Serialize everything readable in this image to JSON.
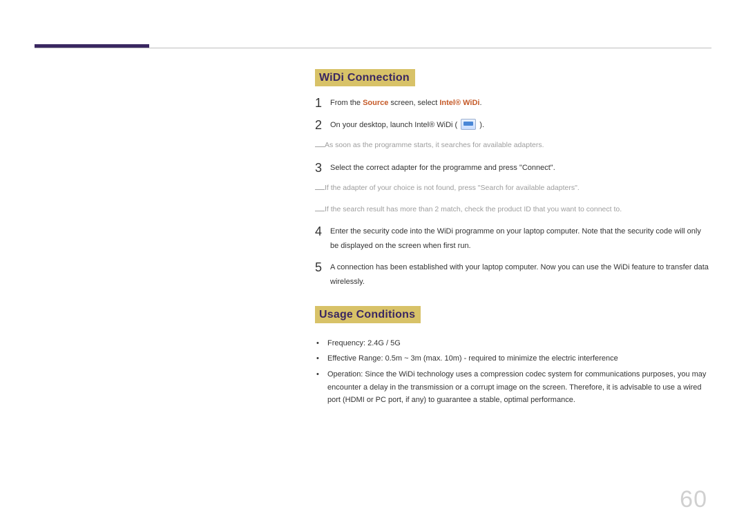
{
  "page_number": "60",
  "section1": {
    "title": "WiDi Connection",
    "steps": [
      {
        "num": "1",
        "pre": "From the ",
        "bold1": "Source",
        "mid": " screen, select ",
        "bold2": "Intel® WiDi",
        "post": "."
      },
      {
        "num": "2",
        "text_pre": "On your desktop, launch Intel® WiDi ( ",
        "text_post": " )."
      },
      {
        "num": "3",
        "text": "Select the correct adapter for the programme and press \"Connect\"."
      },
      {
        "num": "4",
        "text": "Enter the security code into the WiDi programme on your laptop computer. Note that the security code will only be displayed on the screen when first run."
      },
      {
        "num": "5",
        "text": "A connection has been established with your laptop computer. Now you can use the WiDi feature to transfer data wirelessly."
      }
    ],
    "notes_after_2": [
      "As soon as the programme starts, it searches for available adapters."
    ],
    "notes_after_3": [
      "If the adapter of your choice is not found, press \"Search for available adapters\".",
      "If the search result has more than 2 match, check the product ID that you want to connect to."
    ]
  },
  "section2": {
    "title": "Usage Conditions",
    "bullets": [
      "Frequency: 2.4G / 5G",
      "Effective Range: 0.5m ~ 3m (max. 10m) - required to minimize the electric interference",
      "Operation: Since the WiDi technology uses a compression codec system for communications purposes, you may encounter a delay in the transmission or a corrupt image on the screen. Therefore, it is advisable to use a wired port (HDMI or PC port, if any) to guarantee a stable, optimal performance."
    ]
  }
}
